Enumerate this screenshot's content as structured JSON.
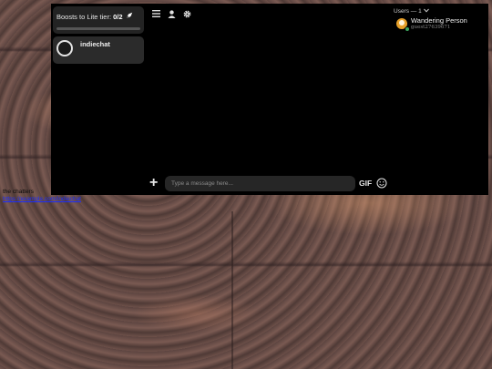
{
  "sidebar": {
    "boost": {
      "label": "Boosts to Lite tier:",
      "count": "0/2",
      "icon": "rocket-icon",
      "progress": 0
    },
    "servers": [
      {
        "name": "indiechat"
      }
    ]
  },
  "toolbar": {
    "icons": [
      "menu-icon",
      "user-icon",
      "gear-icon"
    ]
  },
  "users": {
    "header": "Users — 1",
    "members": [
      {
        "name": "Wandering Person",
        "id": "guest27639671",
        "status": "online",
        "avatar_color": "#e8a12a"
      }
    ]
  },
  "composer": {
    "placeholder": "Type a message here...",
    "gif_label": "GIF"
  },
  "footer": {
    "text": "the chatters",
    "link": "https://example.com/indiechat"
  }
}
